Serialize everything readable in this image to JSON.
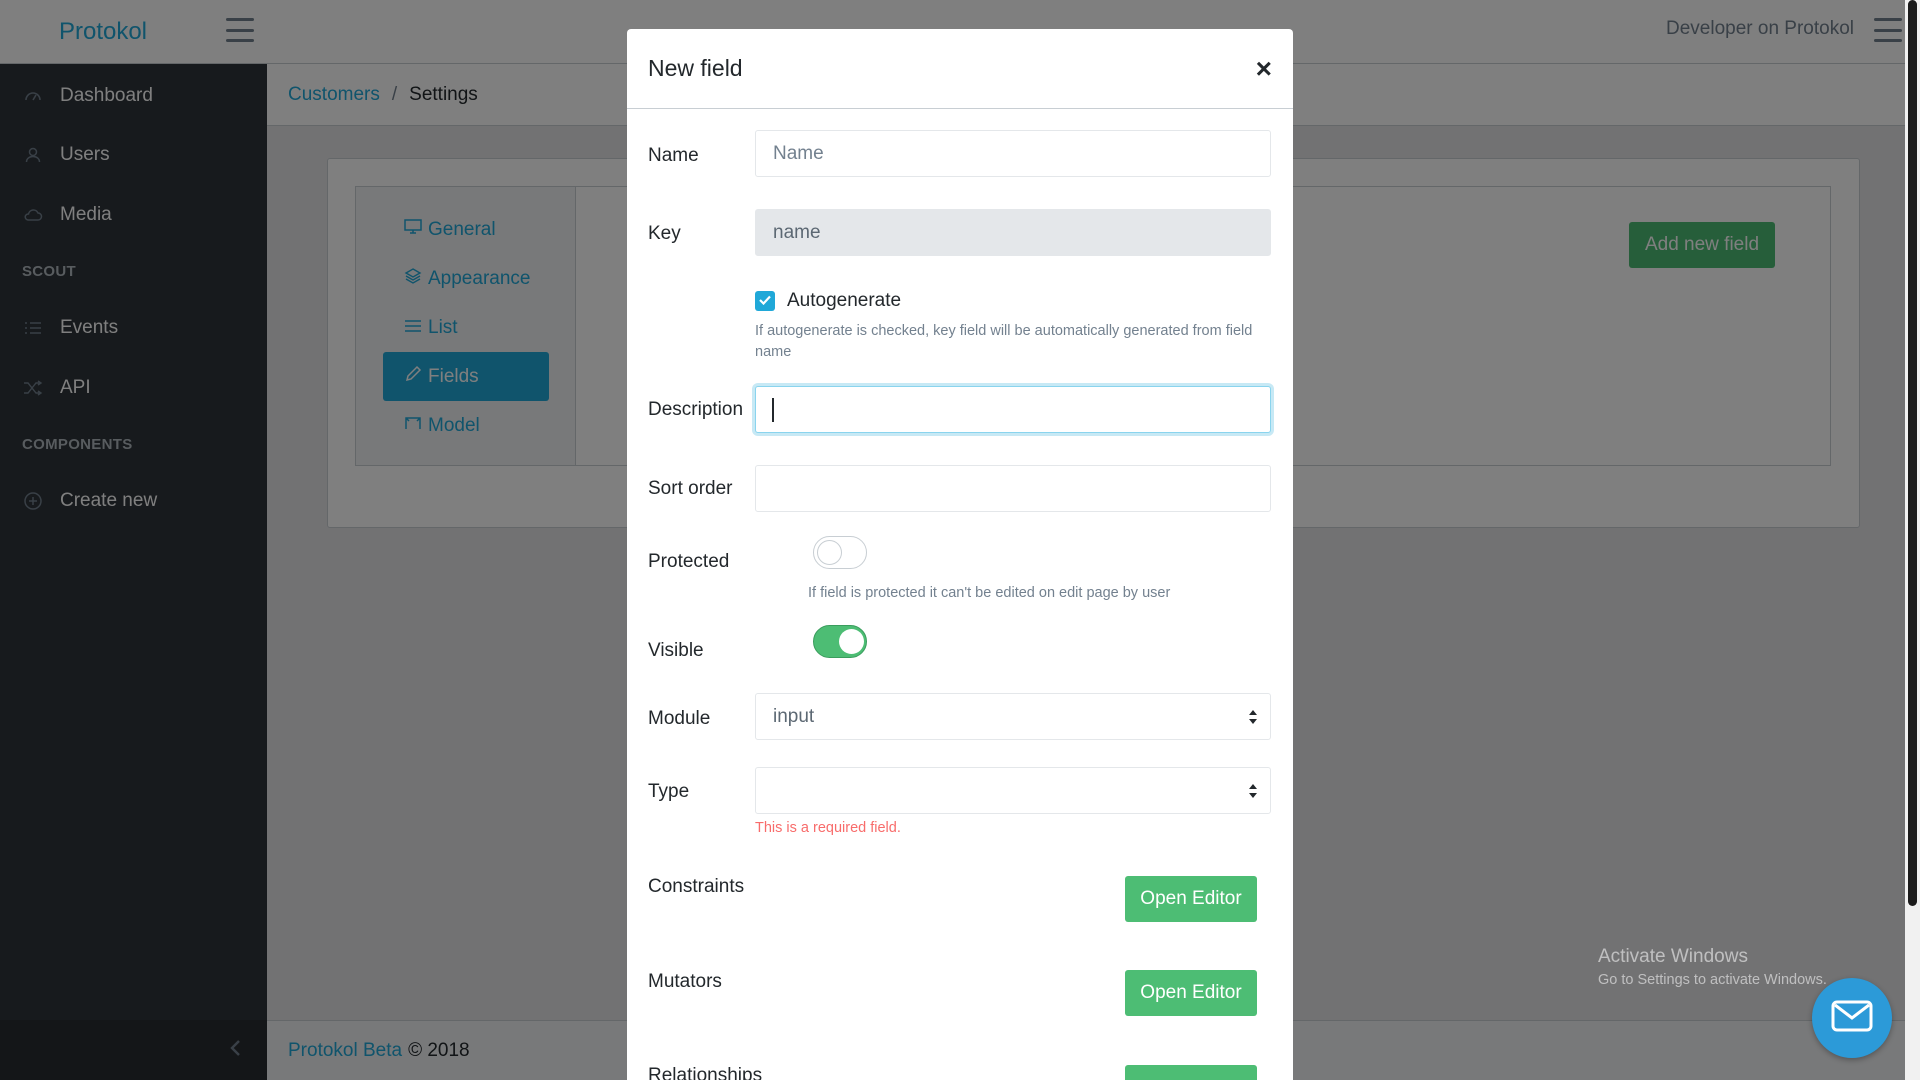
{
  "header": {
    "brand": "Protokol",
    "user_label": "Developer on Protokol"
  },
  "sidebar": {
    "items": [
      {
        "label": "Dashboard",
        "icon": "speedometer-icon"
      },
      {
        "label": "Users",
        "icon": "user-icon"
      },
      {
        "label": "Media",
        "icon": "cloud-icon"
      }
    ],
    "section_scout": "SCOUT",
    "scout_items": [
      {
        "label": "Events",
        "icon": "list-icon"
      },
      {
        "label": "API",
        "icon": "shuffle-icon"
      }
    ],
    "section_components": "COMPONENTS",
    "component_items": [
      {
        "label": "Create new",
        "icon": "plus-circle-icon"
      }
    ]
  },
  "breadcrumb": {
    "parent": "Customers",
    "separator": "/",
    "current": "Settings"
  },
  "settings_tabs": [
    {
      "label": "General",
      "icon": "monitor-icon"
    },
    {
      "label": "Appearance",
      "icon": "layers-icon"
    },
    {
      "label": "List",
      "icon": "list-icon"
    },
    {
      "label": "Fields",
      "icon": "pencil-icon",
      "active": true
    },
    {
      "label": "Model",
      "icon": "frame-icon"
    }
  ],
  "add_new_field_label": "Add new field",
  "footer": {
    "link": "Protokol Beta",
    "copyright": "© 2018"
  },
  "modal": {
    "title": "New field",
    "close": "×",
    "name": {
      "label": "Name",
      "placeholder": "Name",
      "value": ""
    },
    "key": {
      "label": "Key",
      "value": "name"
    },
    "autogenerate": {
      "label": "Autogenerate",
      "checked": true,
      "help": "If autogenerate is checked, key field will be automatically generated from field name"
    },
    "description": {
      "label": "Description",
      "value": ""
    },
    "sort_order": {
      "label": "Sort order",
      "value": ""
    },
    "protected": {
      "label": "Protected",
      "on": false,
      "help": "If field is protected it can't be edited on edit page by user"
    },
    "visible": {
      "label": "Visible",
      "on": true
    },
    "module": {
      "label": "Module",
      "value": "input"
    },
    "type": {
      "label": "Type",
      "value": "",
      "error": "This is a required field."
    },
    "constraints": {
      "label": "Constraints",
      "button": "Open Editor"
    },
    "mutators": {
      "label": "Mutators",
      "button": "Open Editor"
    },
    "relationships": {
      "label": "Relationships"
    }
  },
  "watermark": {
    "line1": "Activate Windows",
    "line2": "Go to Settings to activate Windows."
  },
  "colors": {
    "primary": "#20a8d8",
    "success": "#4dbd74",
    "danger": "#f86c6b",
    "sidebar": "#2f353a"
  }
}
